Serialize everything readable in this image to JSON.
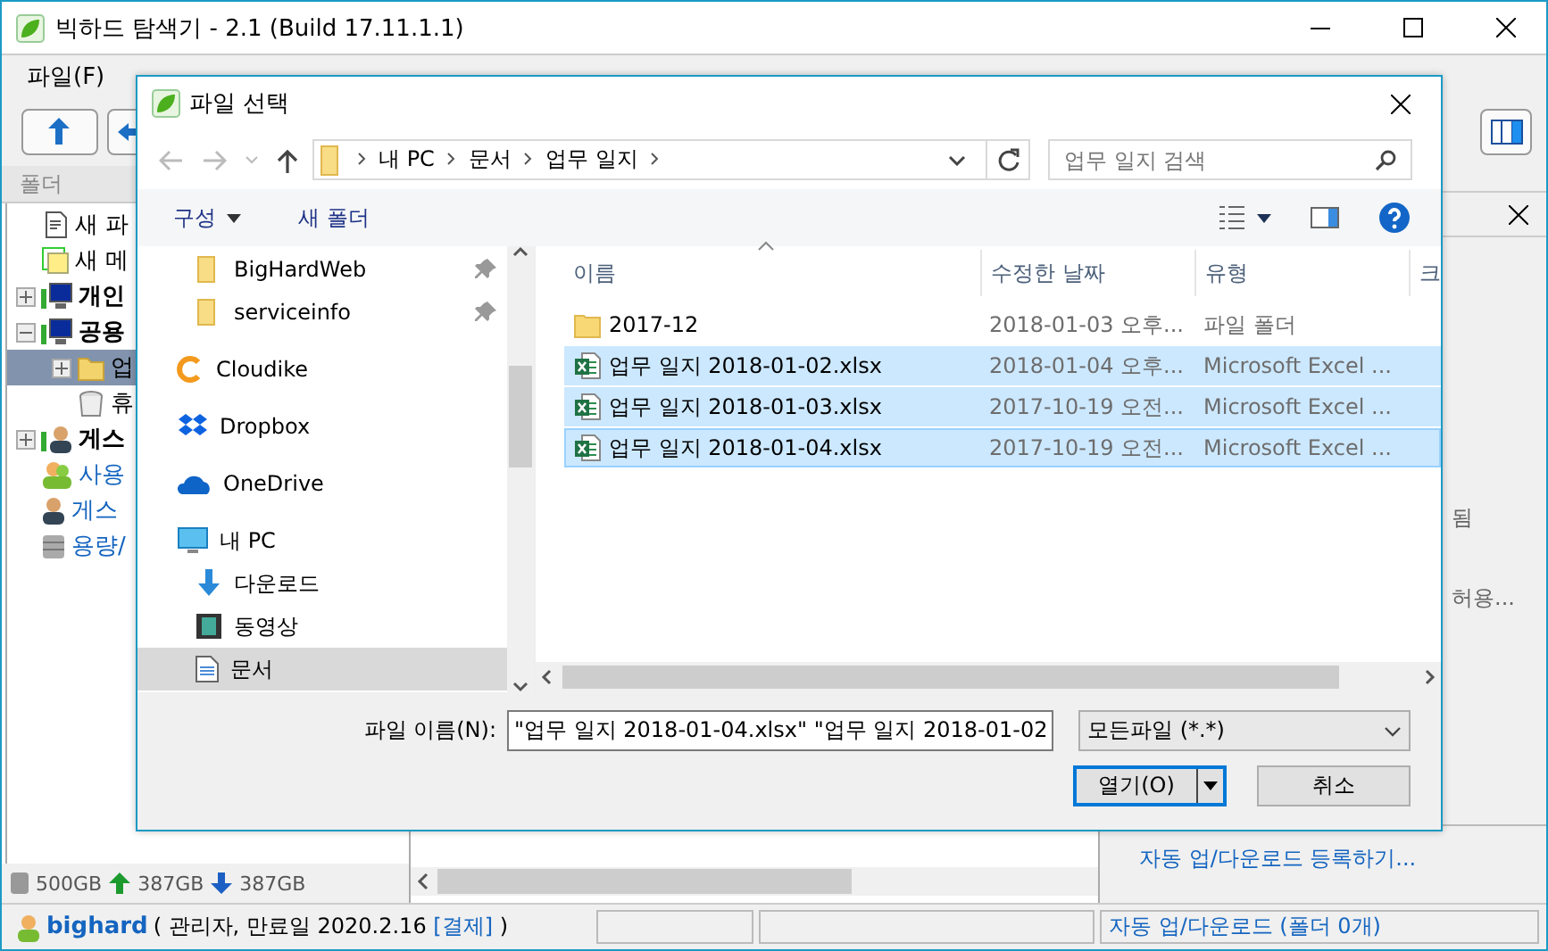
{
  "window": {
    "title": "빅하드 탐색기 - 2.1 (Build 17.11.1.1)"
  },
  "menu": [
    {
      "label": "파일(F)"
    }
  ],
  "left_panel": {
    "header": "폴더",
    "tree": [
      {
        "label": "새 파",
        "kind": "new-file",
        "selected": false
      },
      {
        "label": "새 메",
        "kind": "memo",
        "selected": false
      },
      {
        "label": "개인",
        "kind": "group",
        "expanded": false,
        "selected": false
      },
      {
        "label": "공용",
        "kind": "group",
        "expanded": true,
        "selected": false,
        "children": [
          {
            "label": "업",
            "kind": "folder",
            "expanded": false,
            "selected": true
          },
          {
            "label": "휴",
            "kind": "trash",
            "selected": false
          }
        ]
      },
      {
        "label": "게스",
        "kind": "guest-group",
        "expanded": false,
        "selected": false
      },
      {
        "label": "사용",
        "kind": "users-link",
        "selected": false
      },
      {
        "label": "게스",
        "kind": "guest-link",
        "selected": false
      },
      {
        "label": "용량/",
        "kind": "storage-link",
        "selected": false
      }
    ],
    "usage": {
      "total": "500GB",
      "upload": "387GB",
      "download": "387GB"
    }
  },
  "right_panel": {
    "texts": [
      "됨",
      "허용..."
    ],
    "link": "자동 업/다운로드 등록하기..."
  },
  "status_bar": {
    "user": "bighard",
    "info": "( 관리자, 만료일 2020.2.16 ",
    "pay_link": "[결제]",
    "close": " )",
    "sync": "자동 업/다운로드 (폴더 0개)"
  },
  "dialog": {
    "title": "파일 선택",
    "breadcrumb": [
      "내 PC",
      "문서",
      "업무 일지"
    ],
    "search": {
      "placeholder": "업무 일지 검색"
    },
    "toolbar": [
      "구성",
      "새 폴더"
    ],
    "nav": [
      {
        "label": "BigHardWeb",
        "kind": "folder",
        "pinned": true,
        "selected": false
      },
      {
        "label": "serviceinfo",
        "kind": "folder",
        "pinned": true,
        "selected": false
      },
      {
        "label": "Cloudike",
        "kind": "cloudike",
        "pinned": false,
        "selected": false
      },
      {
        "label": "Dropbox",
        "kind": "dropbox",
        "pinned": false,
        "selected": false
      },
      {
        "label": "OneDrive",
        "kind": "onedrive",
        "pinned": false,
        "selected": false
      },
      {
        "label": "내 PC",
        "kind": "pc",
        "pinned": false,
        "selected": false,
        "children": [
          {
            "label": "다운로드",
            "kind": "download",
            "pinned": false,
            "selected": false
          },
          {
            "label": "동영상",
            "kind": "video",
            "pinned": false,
            "selected": false
          },
          {
            "label": "문서",
            "kind": "document",
            "pinned": false,
            "selected": true
          }
        ]
      }
    ],
    "columns": [
      "이름",
      "수정한 날짜",
      "유형",
      "크"
    ],
    "rows": [
      {
        "name": "2017-12",
        "date": "2018-01-03 오후...",
        "type": "파일 폴더",
        "kind": "folder",
        "selected": false
      },
      {
        "name": "업무 일지 2018-01-02.xlsx",
        "date": "2018-01-04 오후...",
        "type": "Microsoft Excel ...",
        "kind": "excel",
        "selected": true
      },
      {
        "name": "업무 일지 2018-01-03.xlsx",
        "date": "2017-10-19 오전...",
        "type": "Microsoft Excel ...",
        "kind": "excel",
        "selected": true
      },
      {
        "name": "업무 일지 2018-01-04.xlsx",
        "date": "2017-10-19 오전...",
        "type": "Microsoft Excel ...",
        "kind": "excel",
        "selected": true
      }
    ],
    "filename": {
      "label": "파일 이름(N):",
      "value": "\"업무 일지 2018-01-04.xlsx\" \"업무 일지 2018-01-02"
    },
    "filetype": "모든파일 (*.*)",
    "buttons": [
      "열기(O)",
      "취소"
    ]
  }
}
